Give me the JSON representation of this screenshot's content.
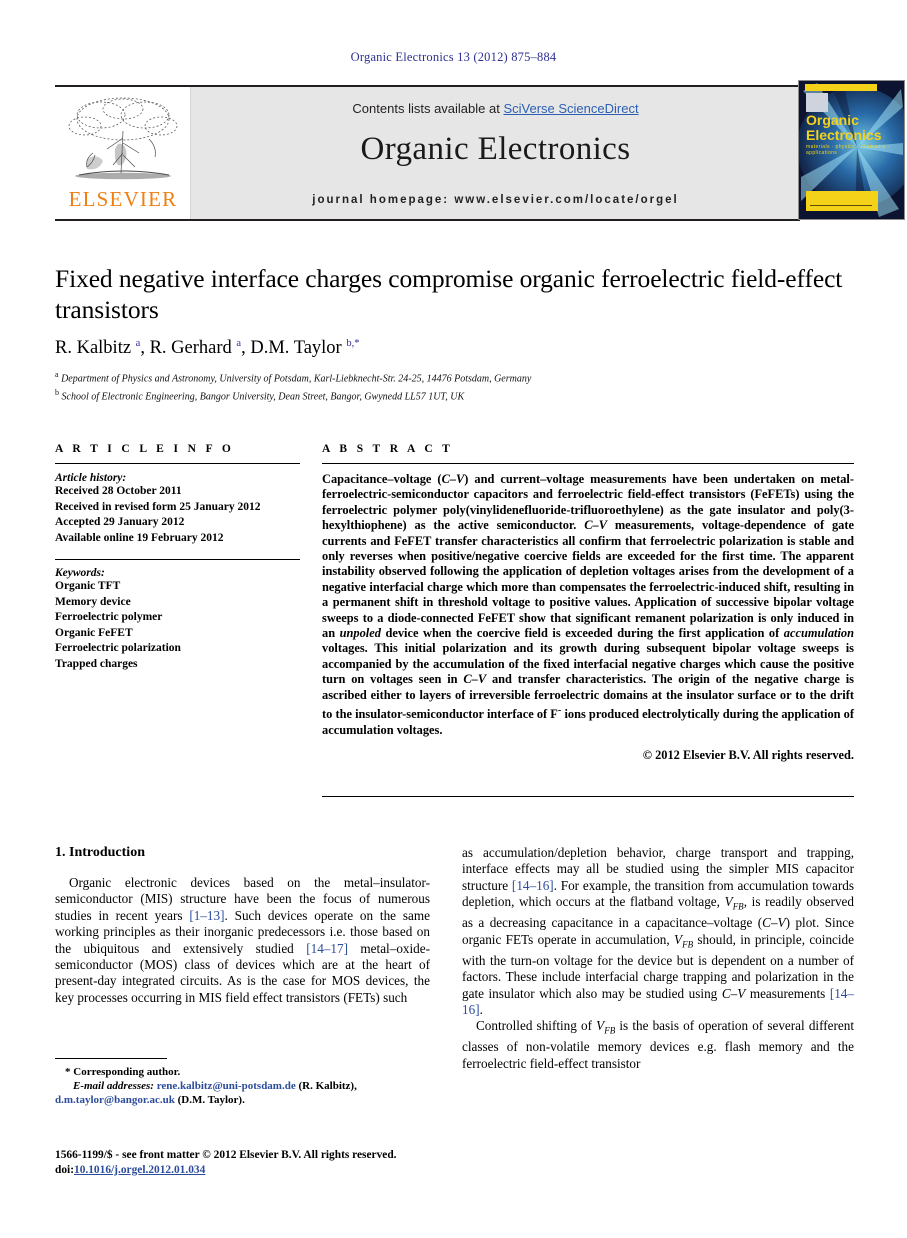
{
  "running_head": "Organic Electronics 13 (2012) 875–884",
  "masthead": {
    "contents_prefix": "Contents lists available at ",
    "sciencedirect": "SciVerse ScienceDirect",
    "journal_title": "Organic Electronics",
    "homepage": "journal homepage: www.elsevier.com/locate/orgel",
    "publisher_wordmark": "ELSEVIER",
    "cover": {
      "title_line1": "Organic",
      "title_line2": "Electronics",
      "subtitle": "materials  ·  physics  ·  chemistry  ·  applications"
    }
  },
  "article": {
    "title": "Fixed negative interface charges compromise organic ferroelectric field-effect transistors",
    "authors_html": "R. Kalbitz <sup>a</sup>, R. Gerhard <sup>a</sup>, D.M. Taylor <sup>b,*</sup>",
    "affiliations": [
      {
        "marker": "a",
        "text": "Department of Physics and Astronomy, University of Potsdam, Karl-Liebknecht-Str. 24-25, 14476 Potsdam, Germany"
      },
      {
        "marker": "b",
        "text": "School of Electronic Engineering, Bangor University, Dean Street, Bangor, Gwynedd LL57 1UT, UK"
      }
    ]
  },
  "info": {
    "heading": "A R T I C L E    I N F O",
    "history_label": "Article history:",
    "history": [
      "Received 28 October 2011",
      "Received in revised form 25 January 2012",
      "Accepted 29 January 2012",
      "Available online 19 February 2012"
    ],
    "keywords_label": "Keywords:",
    "keywords": [
      "Organic TFT",
      "Memory device",
      "Ferroelectric polymer",
      "Organic FeFET",
      "Ferroelectric polarization",
      "Trapped charges"
    ]
  },
  "abstract": {
    "heading": "A B S T R A C T",
    "body_html": "Capacitance–voltage (<i>C–V</i>) and current–voltage measurements have been undertaken on metal-ferroelectric-semiconductor capacitors and ferroelectric field-effect transistors (FeFETs) using the ferroelectric polymer poly(vinylidenefluoride-trifluoroethylene) as the gate insulator and poly(3-hexylthiophene) as the active semiconductor. <i>C–V</i> measurements, voltage-dependence of gate currents and FeFET transfer characteristics all confirm that ferroelectric polarization is stable and only reverses when positive/negative coercive fields are exceeded for the first time. The apparent instability observed following the application of depletion voltages arises from the development of a negative interfacial charge which more than compensates the ferroelectric-induced shift, resulting in a permanent shift in threshold voltage to positive values. Application of successive bipolar voltage sweeps to a diode-connected FeFET show that significant remanent polarization is only induced in an <i>unpoled</i> device when the coercive field is exceeded during the first application of <i>accumulation</i> voltages. This initial polarization and its growth during subsequent bipolar voltage sweeps is accompanied by the accumulation of the fixed interfacial negative charges which cause the positive turn on voltages seen in <i>C–V</i> and transfer characteristics. The origin of the negative charge is ascribed either to layers of irreversible ferroelectric domains at the insulator surface or to the drift to the insulator-semiconductor interface of F<sup>-</sup> ions produced electrolytically during the application of accumulation voltages.",
    "copyright": "© 2012 Elsevier B.V. All rights reserved."
  },
  "body": {
    "section_title": "1. Introduction",
    "left_paragraph_html": "Organic electronic devices based on the metal–insulator-semiconductor (MIS) structure have been the focus of numerous studies in recent years <span class=\"ref-link\">[1–13]</span>. Such devices operate on the same working principles as their inorganic predecessors i.e. those based on the ubiquitous and extensively studied <span class=\"ref-link\">[14–17]</span> metal–oxide-semiconductor (MOS) class of devices which are at the heart of present-day integrated circuits. As is the case for MOS devices, the key processes occurring in MIS field effect transistors (FETs) such",
    "right_paragraph_1_html": "as accumulation/depletion behavior, charge transport and trapping, interface effects may all be studied using the simpler MIS capacitor structure <span class=\"ref-link\">[14–16]</span>. For example, the transition from accumulation towards depletion, which occurs at the flatband voltage, <span class=\"vfb\">V<sub>FB</sub></span>, is readily observed as a decreasing capacitance in a capacitance–voltage (<i>C–V</i>) plot. Since organic FETs operate in accumulation, <span class=\"vfb\">V<sub>FB</sub></span> should, in principle, coincide with the turn-on voltage for the device but is dependent on a number of factors. These include interfacial charge trapping and polarization in the gate insulator which also may be studied using <i>C–V</i> measurements <span class=\"ref-link\">[14–16]</span>.",
    "right_paragraph_2_html": "Controlled shifting of <span class=\"vfb\">V<sub>FB</sub></span> is the basis of operation of several different classes of non-volatile memory devices e.g. flash memory and the ferroelectric field-effect transistor"
  },
  "footnote": {
    "corresponding_html": "* Corresponding author.",
    "email_html": "<i>E-mail addresses:</i> <span class=\"mail\">rene.kalbitz@uni-potsdam.de</span> (R. Kalbitz), <span class=\"mail\">d.m.taylor@bangor.ac.uk</span> (D.M. Taylor)."
  },
  "issn": {
    "line1_html": "1566-1199/$ - see front matter © 2012 Elsevier B.V. All rights reserved.",
    "line2_prefix": "doi:",
    "line2_link": "10.1016/j.orgel.2012.01.034"
  }
}
